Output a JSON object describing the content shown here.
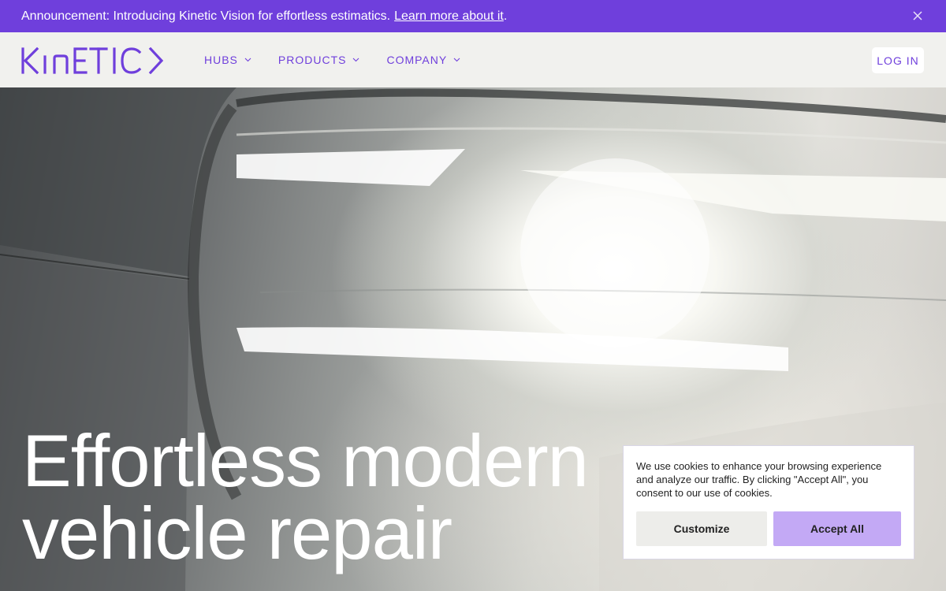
{
  "announcement": {
    "text": "Announcement: Introducing Kinetic Vision for effortless estimatics.",
    "link_text": "Learn more about it",
    "suffix": "."
  },
  "nav": {
    "logo_text": "KINETIC",
    "items": [
      {
        "label": "HUBS"
      },
      {
        "label": "PRODUCTS"
      },
      {
        "label": "COMPANY"
      }
    ],
    "login_label": "LOG IN"
  },
  "hero": {
    "headline_line1": "Effortless modern",
    "headline_line2": "vehicle repair"
  },
  "cookie": {
    "message": "We use cookies to enhance your browsing experience and analyze our traffic. By clicking \"Accept All\", you consent to our use of cookies.",
    "customize_label": "Customize",
    "accept_label": "Accept All"
  },
  "colors": {
    "brand": "#6f3fdc",
    "accept_button": "#c3a9f5",
    "nav_background": "#f1f1ee"
  }
}
